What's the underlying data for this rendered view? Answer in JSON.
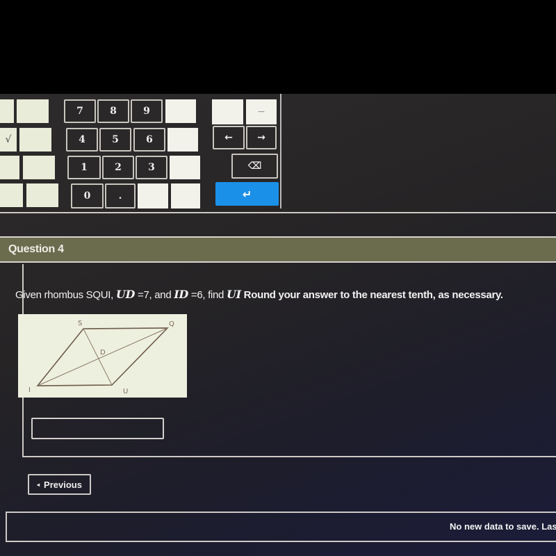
{
  "keypad": {
    "digits": [
      "7",
      "8",
      "9",
      "4",
      "5",
      "6",
      "1",
      "2",
      "3",
      "0",
      "."
    ],
    "left_partial_symbol": "√",
    "minus_symbol": "−",
    "left_arrow": "←",
    "right_arrow": "→",
    "backspace_symbol": "⌫",
    "enter_symbol": "↵",
    "enter_color": "#1b90e8"
  },
  "question": {
    "title": "Question 4",
    "text_parts": {
      "p1": "Given rhombus SQUI, ",
      "m1": "UD",
      "p2": " =7, and ",
      "m2": "ID",
      "p3": " =6, find ",
      "m3": "UI",
      "p4": "  Round your answer to the nearest tenth, as necessary."
    },
    "figure": {
      "vertices": {
        "S": "S",
        "Q": "Q",
        "U": "U",
        "I": "I",
        "D": "D"
      }
    },
    "answer": {
      "value": "",
      "placeholder": ""
    }
  },
  "navigation": {
    "previous_label": "Previous",
    "previous_icon": "◂"
  },
  "status": {
    "text": "No new data to save. Last c"
  }
}
